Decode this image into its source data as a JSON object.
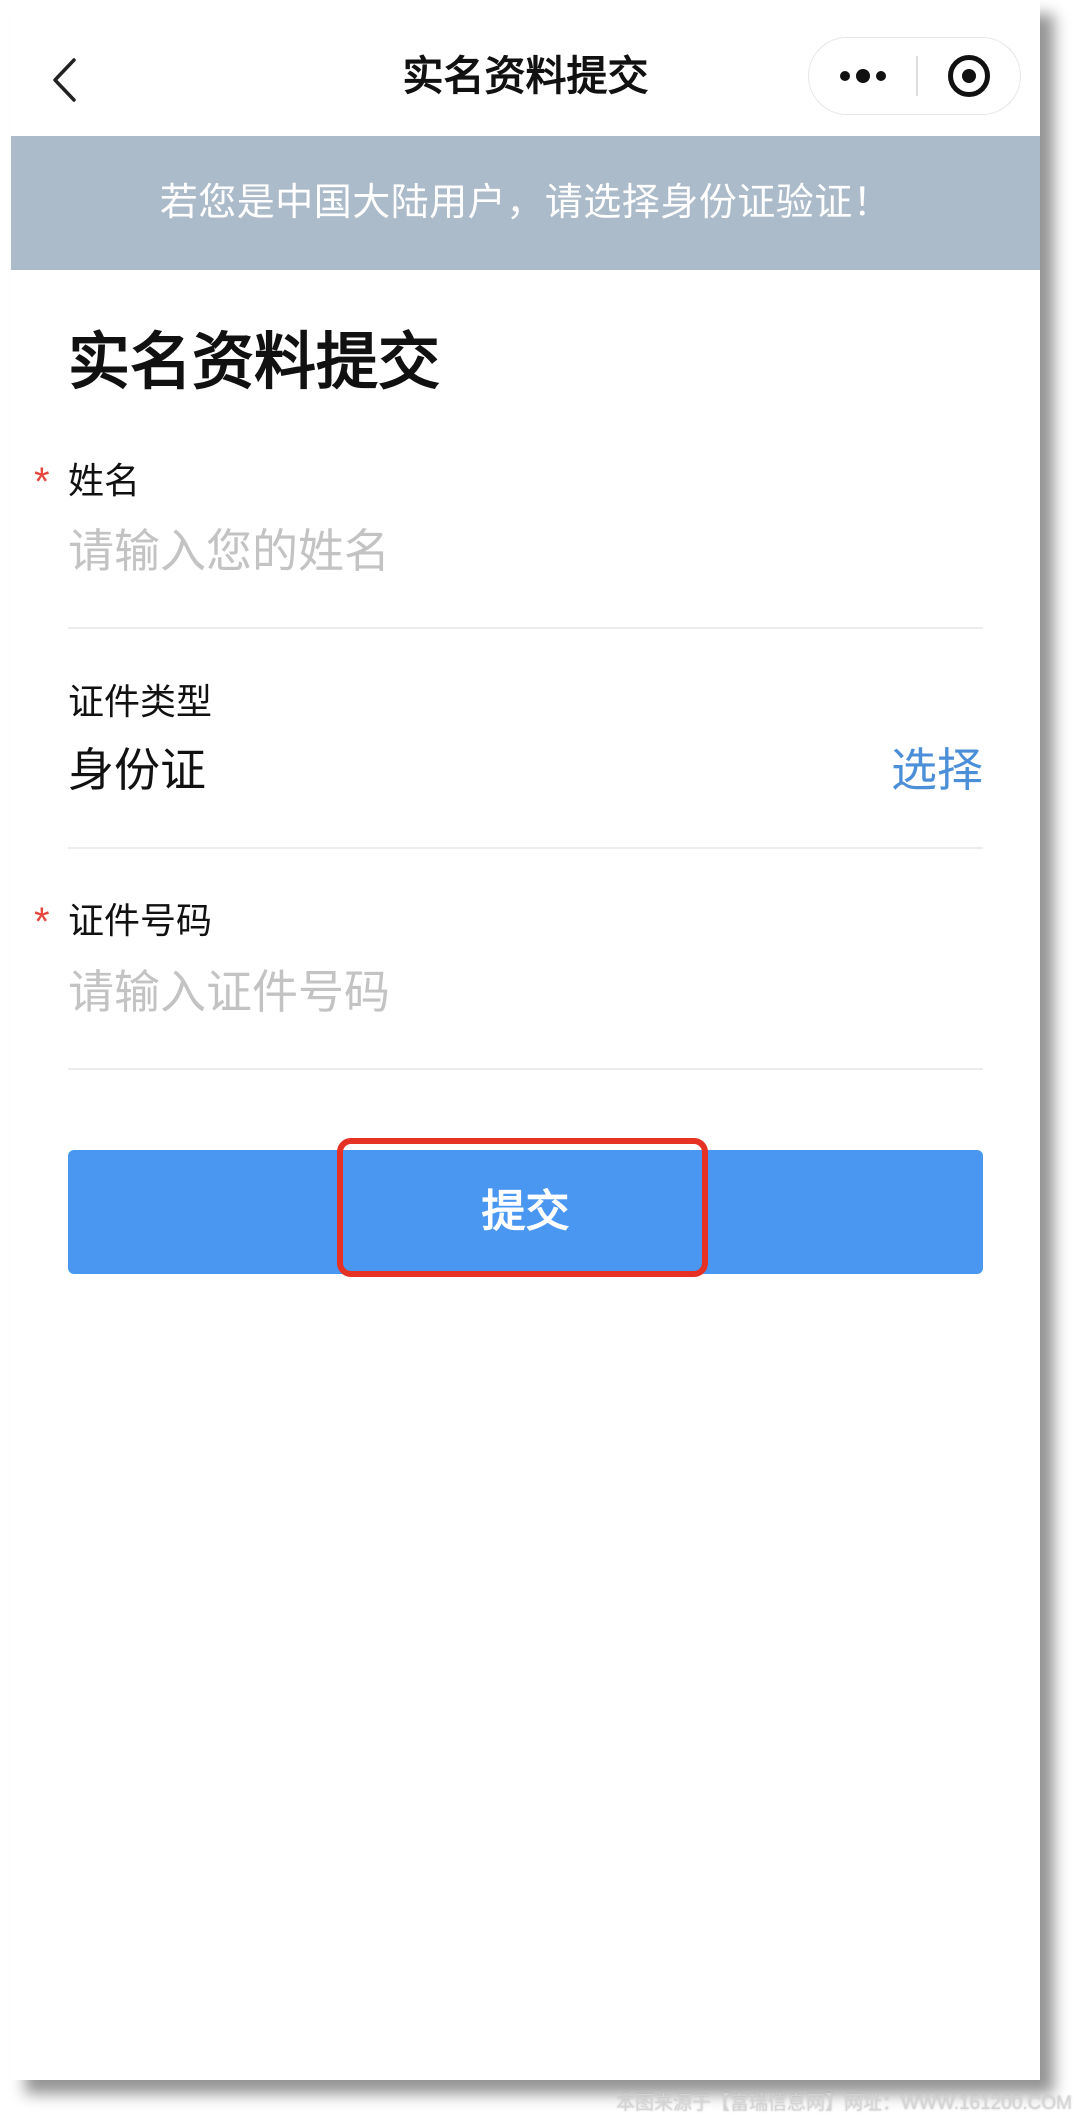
{
  "header": {
    "title": "实名资料提交",
    "back_icon": "chevron-left-icon",
    "more_icon": "more-icon",
    "close_icon": "target-icon"
  },
  "banner": {
    "text": "若您是中国大陆用户，请选择身份证验证！"
  },
  "form": {
    "heading": "实名资料提交",
    "name": {
      "required_mark": "*",
      "label": "姓名",
      "placeholder": "请输入您的姓名",
      "value": ""
    },
    "id_type": {
      "label": "证件类型",
      "value": "身份证",
      "action_label": "选择"
    },
    "id_number": {
      "required_mark": "*",
      "label": "证件号码",
      "placeholder": "请输入证件号码",
      "value": ""
    },
    "submit_label": "提交"
  },
  "watermark": "本图来源于【富瑞信息网】网址：WWW.161200.COM",
  "colors": {
    "accent": "#4a97f2",
    "banner_bg": "#acbbc9",
    "required": "#e5473f",
    "link": "#4b8fd9",
    "highlight": "#e53224"
  }
}
